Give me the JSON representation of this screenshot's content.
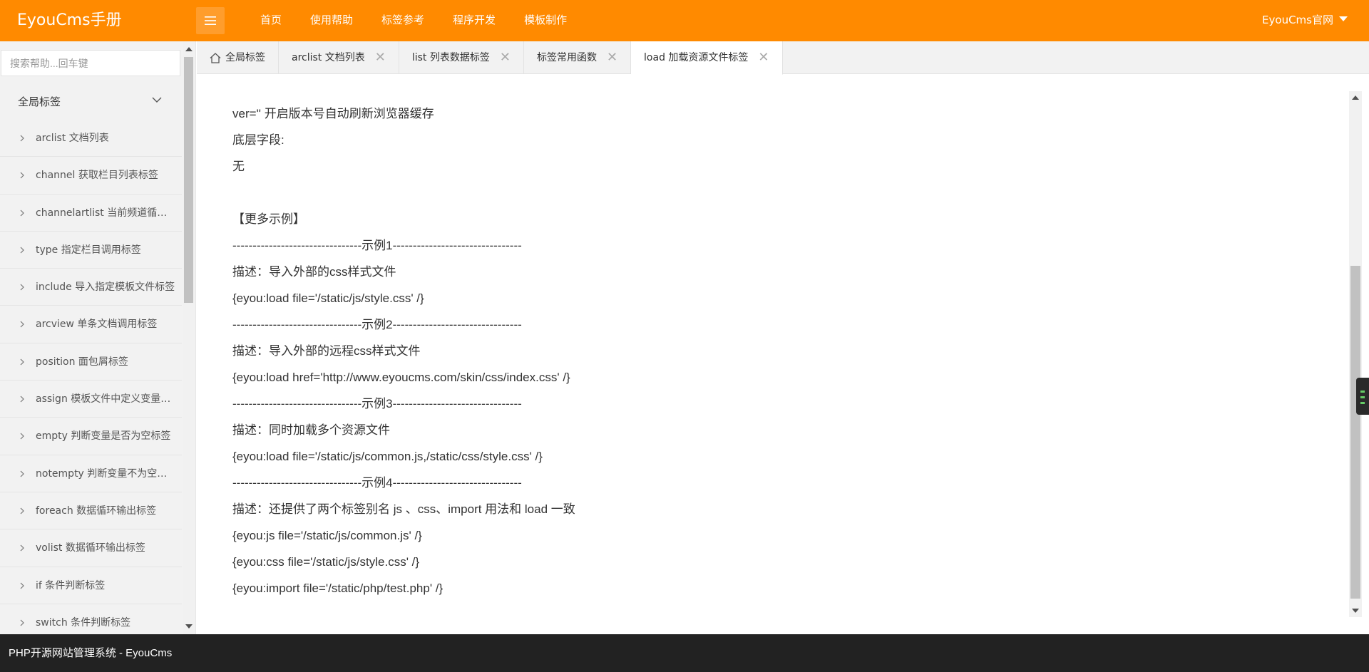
{
  "header": {
    "logo": "EyouCms手册",
    "nav": [
      "首页",
      "使用帮助",
      "标签参考",
      "程序开发",
      "模板制作"
    ],
    "official": "EyouCms官网"
  },
  "sidebar": {
    "search_placeholder": "搜索帮助...回车键",
    "group_title": "全局标签",
    "items": [
      "arclist 文档列表",
      "channel 获取栏目列表标签",
      "channelartlist 当前频道循环标签",
      "type 指定栏目调用标签",
      "include 导入指定模板文件标签",
      "arcview 单条文档调用标签",
      "position 面包屑标签",
      "assign 模板文件中定义变量标签",
      "empty 判断变量是否为空标签",
      "notempty 判断变量不为空标签",
      "foreach 数据循环输出标签",
      "volist 数据循环输出标签",
      "if 条件判断标签",
      "switch 条件判断标签"
    ]
  },
  "tabs": [
    {
      "label": "全局标签",
      "home": true,
      "closable": false
    },
    {
      "label": "arclist 文档列表",
      "closable": true
    },
    {
      "label": "list 列表数据标签",
      "closable": true
    },
    {
      "label": "标签常用函数",
      "closable": true
    },
    {
      "label": "load 加载资源文件标签",
      "closable": true,
      "active": true
    }
  ],
  "content": {
    "lines": [
      "ver='' 开启版本号自动刷新浏览器缓存",
      "底层字段:",
      "无",
      "",
      "【更多示例】",
      "--------------------------------示例1--------------------------------",
      "描述：导入外部的css样式文件",
      "{eyou:load file='/static/js/style.css' /}",
      "--------------------------------示例2--------------------------------",
      "描述：导入外部的远程css样式文件",
      "{eyou:load href='http://www.eyoucms.com/skin/css/index.css' /}",
      "--------------------------------示例3--------------------------------",
      "描述：同时加载多个资源文件",
      "{eyou:load file='/static/js/common.js,/static/css/style.css' /}",
      "--------------------------------示例4--------------------------------",
      "描述：还提供了两个标签别名 js 、css、import 用法和 load 一致",
      "{eyou:js file='/static/js/common.js' /}",
      "{eyou:css file='/static/js/style.css' /}",
      "{eyou:import file='/static/php/test.php' /}"
    ]
  },
  "footer": {
    "text": "PHP开源网站管理系统 - EyouCms"
  },
  "colors": {
    "header": "#ff8a00",
    "footer": "#222222",
    "sidebar": "#f2f2f2"
  }
}
